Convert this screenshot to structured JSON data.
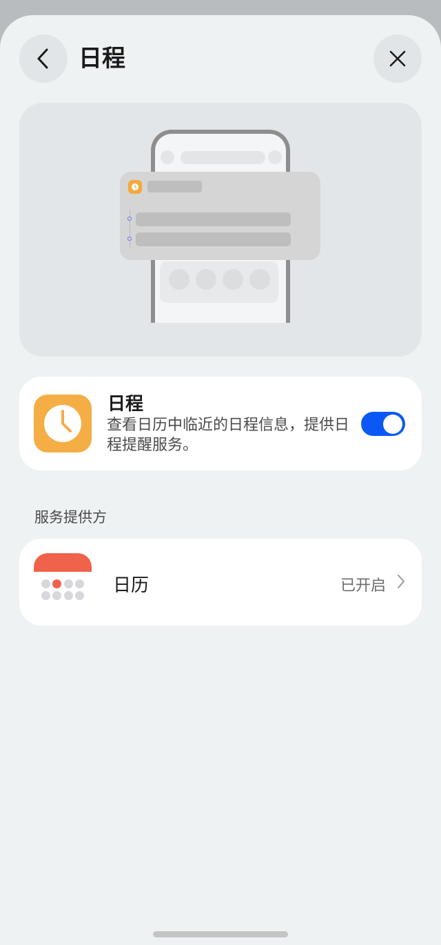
{
  "header": {
    "title": "日程",
    "back_icon": "chevron-left-icon",
    "close_icon": "close-icon"
  },
  "schedule": {
    "title": "日程",
    "description": "查看日历中临近的日程信息，提供日程提醒服务。",
    "icon": "clock-icon",
    "icon_color": "#f5ad45",
    "toggle_on": true,
    "toggle_color": "#0a59f7"
  },
  "providers": {
    "section_title": "服务提供方",
    "items": [
      {
        "name": "日历",
        "status": "已开启",
        "icon": "calendar-icon",
        "icon_color": "#f0624a"
      }
    ]
  }
}
